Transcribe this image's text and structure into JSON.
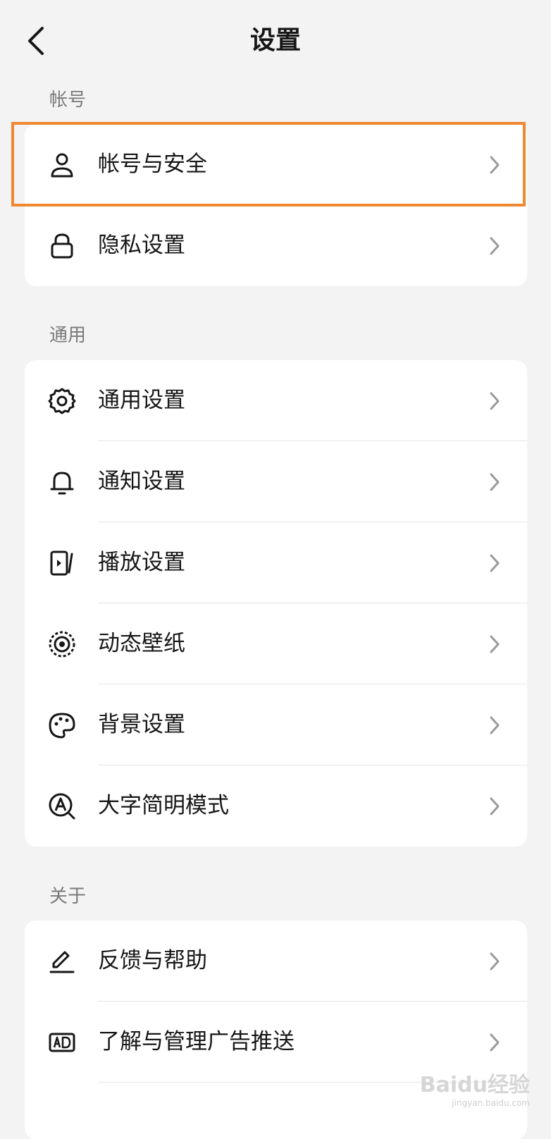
{
  "header": {
    "title": "设置",
    "back_icon": "chevron-left-icon"
  },
  "sections": [
    {
      "label": "帐号",
      "items": [
        {
          "label": "帐号与安全",
          "icon": "user-icon"
        },
        {
          "label": "隐私设置",
          "icon": "lock-icon"
        }
      ]
    },
    {
      "label": "通用",
      "items": [
        {
          "label": "通用设置",
          "icon": "gear-icon"
        },
        {
          "label": "通知设置",
          "icon": "bell-icon"
        },
        {
          "label": "播放设置",
          "icon": "play-panel-icon"
        },
        {
          "label": "动态壁纸",
          "icon": "live-wallpaper-icon"
        },
        {
          "label": "背景设置",
          "icon": "palette-icon"
        },
        {
          "label": "大字简明模式",
          "icon": "font-zoom-icon"
        }
      ]
    },
    {
      "label": "关于",
      "items": [
        {
          "label": "反馈与帮助",
          "icon": "pen-icon"
        },
        {
          "label": "了解与管理广告推送",
          "icon": "ad-icon"
        }
      ]
    }
  ],
  "highlight_color": "#f08830",
  "watermark": {
    "text": "Baidu经验",
    "sub": "jingyan.baidu.com"
  }
}
